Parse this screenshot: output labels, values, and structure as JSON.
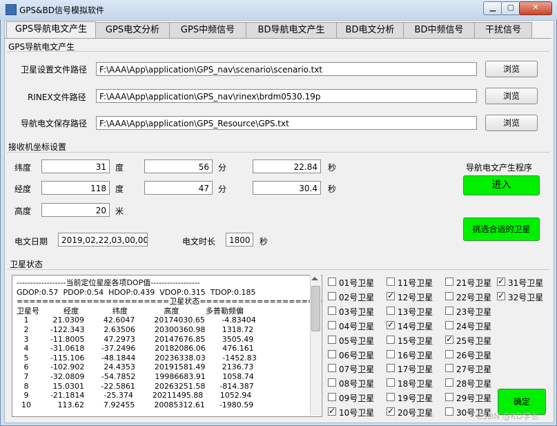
{
  "window": {
    "title": "GPS&BD信号模拟软件",
    "min": "▁",
    "max": "▢",
    "close": "✕"
  },
  "tabs": [
    "GPS导航电文产生",
    "GPS电文分析",
    "GPS中频信号",
    "BD导航电文产生",
    "BD电文分析",
    "BD中频信号",
    "干扰信号"
  ],
  "section_nav": {
    "title": "GPS导航电文产生",
    "rows": [
      {
        "label": "卫星设置文件路径",
        "value": "F:\\AAA\\App\\application\\GPS_nav\\scenario\\scenario.txt",
        "button": "浏览"
      },
      {
        "label": "RINEX文件路径",
        "value": "F:\\AAA\\App\\application\\GPS_nav\\rinex\\brdm0530.19p",
        "button": "浏览"
      },
      {
        "label": "导航电文保存路径",
        "value": "F:\\AAA\\App\\application\\GPS_Resource\\GPS.txt",
        "button": "浏览"
      }
    ]
  },
  "section_recv": {
    "title": "接收机坐标设置",
    "lat_label": "纬度",
    "lat_deg": "31",
    "lat_min": "56",
    "lat_sec": "22.84",
    "lon_label": "经度",
    "lon_deg": "118",
    "lon_min": "47",
    "lon_sec": "30.4",
    "alt_label": "高度",
    "alt": "20",
    "deg_unit": "度",
    "min_unit": "分",
    "sec_unit": "秒",
    "alt_unit": "米",
    "date_label": "电文日期",
    "date": "2019,02,22,03,00,00",
    "dur_label": "电文时长",
    "dur": "1800",
    "dur_unit": "秒",
    "program_label": "导航电文产生程序",
    "enter_button": "进入",
    "select_button": "挑选合适的卫星"
  },
  "section_sat": {
    "title": "卫星状态",
    "text": "------------------当前定位星座各项DOP值------------------\nGDOP:0.57  PDOP:0.54  HDOP:0.439  VDOP:0.315  TDOP:0.185\n========================卫星状态========================\n卫星号          经度              纬度               高度           多普勒频偏\n   1          21.0309        42.6047        20174030.65       -4.83404\n   2         -122.343        2.63506        20300360.98       1318.72\n   3         -11.8005        47.2973        20147676.85       3505.49\n   4         -31.0618       -37.2496        20182086.06       476.161\n   5         -115.106       -48.1844        20236338.03       -1452.83\n   6         -102.902        24.4353        20191581.49       2136.73\n   7         -32.0809       -54.7852        19986683.91       1058.74\n   8          15.0301       -22.5861        20263251.58      -814.387\n   9         -21.1814        -25.374        20211495.88       1052.94\n  10           113.62        7.92455        20085312.61      -1980.59",
    "confirm_button": "确定"
  },
  "satellites": [
    {
      "label": "01号卫星",
      "checked": false
    },
    {
      "label": "02号卫星",
      "checked": false
    },
    {
      "label": "03号卫星",
      "checked": false
    },
    {
      "label": "04号卫星",
      "checked": false
    },
    {
      "label": "05号卫星",
      "checked": false
    },
    {
      "label": "06号卫星",
      "checked": false
    },
    {
      "label": "07号卫星",
      "checked": false
    },
    {
      "label": "08号卫星",
      "checked": false
    },
    {
      "label": "09号卫星",
      "checked": false
    },
    {
      "label": "10号卫星",
      "checked": true
    },
    {
      "label": "11号卫星",
      "checked": false
    },
    {
      "label": "12号卫星",
      "checked": true
    },
    {
      "label": "13号卫星",
      "checked": false
    },
    {
      "label": "14号卫星",
      "checked": true
    },
    {
      "label": "15号卫星",
      "checked": false
    },
    {
      "label": "16号卫星",
      "checked": false
    },
    {
      "label": "17号卫星",
      "checked": false
    },
    {
      "label": "18号卫星",
      "checked": false
    },
    {
      "label": "19号卫星",
      "checked": false
    },
    {
      "label": "20号卫星",
      "checked": true
    },
    {
      "label": "21号卫星",
      "checked": false
    },
    {
      "label": "22号卫星",
      "checked": false
    },
    {
      "label": "23号卫星",
      "checked": false
    },
    {
      "label": "24号卫星",
      "checked": false
    },
    {
      "label": "25号卫星",
      "checked": true
    },
    {
      "label": "26号卫星",
      "checked": false
    },
    {
      "label": "27号卫星",
      "checked": false
    },
    {
      "label": "28号卫星",
      "checked": false
    },
    {
      "label": "29号卫星",
      "checked": false
    },
    {
      "label": "30号卫星",
      "checked": false
    },
    {
      "label": "31号卫星",
      "checked": true
    },
    {
      "label": "32号卫星",
      "checked": true
    }
  ],
  "watermark": "CSDN @KD学长"
}
